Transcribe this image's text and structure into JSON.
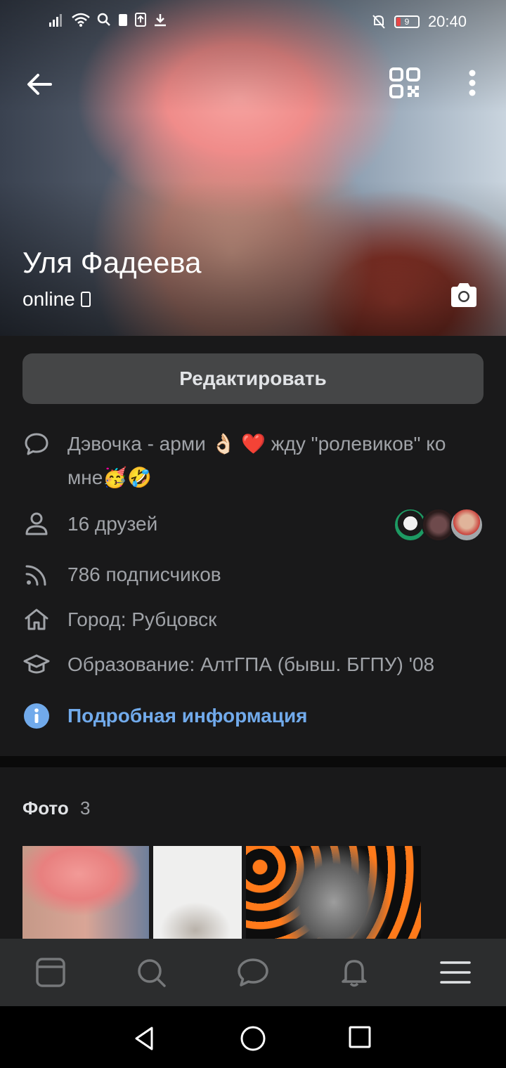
{
  "status_bar": {
    "time": "20:40",
    "battery": "9"
  },
  "profile": {
    "name": "Уля Фадеева",
    "online": "online"
  },
  "actions": {
    "edit_label": "Редактировать"
  },
  "info": {
    "status_text": "Дэвочка - арми 👌🏻 ❤️ жду \"ролевиков\" ко мне🥳🤣",
    "friends": "16 друзей",
    "followers": "786 подписчиков",
    "city": "Город: Рубцовск",
    "education": "Образование: АлтГПА (бывш. БГПУ) '08",
    "more_info": "Подробная информация"
  },
  "photos": {
    "title": "Фото",
    "count": "3"
  },
  "tabs": [
    "news-icon",
    "search-icon",
    "messages-icon",
    "notifications-icon",
    "menu-icon"
  ],
  "colors": {
    "accent": "#71aaeb",
    "background": "#19191a",
    "secondary_text": "#a0a3a8",
    "button": "#454647"
  }
}
